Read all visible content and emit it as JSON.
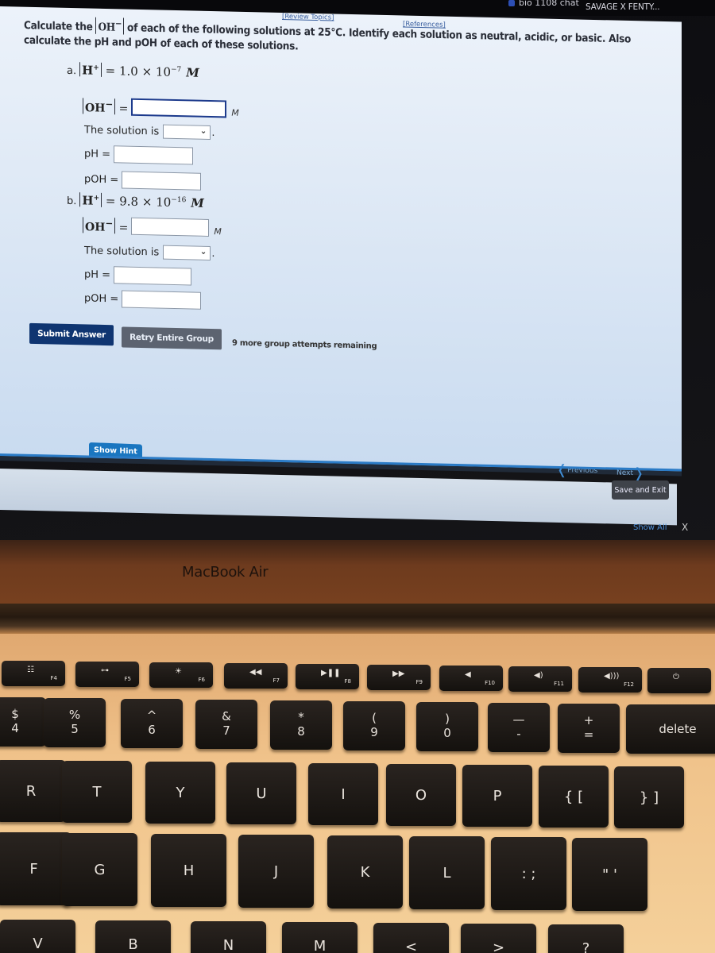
{
  "browser": {
    "tabs": [
      {
        "label": "bio 1108 chat",
        "icon": "favicon-icon"
      },
      {
        "label": "SAVAGE X FENTY..."
      }
    ]
  },
  "links": {
    "review_topics": "[Review Topics]",
    "references": "[References]"
  },
  "question": {
    "text_1": "Calculate the ",
    "chem_oh": "OH",
    "chem_oh_charge": "−",
    "text_2": " of each of the following solutions at 25°C. Identify each solution as neutral, acidic, or basic. Also calculate the pH and pOH of each of these solutions."
  },
  "parts": [
    {
      "letter": "a.",
      "given_species": "H",
      "given_charge": "+",
      "given_value": "= 1.0 × 10",
      "given_exponent": "−7",
      "given_unit": "M",
      "oh_label": "OH",
      "oh_charge": "−",
      "oh_value": "",
      "oh_unit": "M",
      "solution_label": "The solution is",
      "solution_selected": "",
      "ph_label": "pH =",
      "ph_value": "",
      "poh_label": "pOH =",
      "poh_value": ""
    },
    {
      "letter": "b.",
      "given_species": "H",
      "given_charge": "+",
      "given_value": "= 9.8 × 10",
      "given_exponent": "−16",
      "given_unit": "M",
      "oh_label": "OH",
      "oh_charge": "−",
      "oh_value": "",
      "oh_unit": "M",
      "solution_label": "The solution is",
      "solution_selected": "",
      "ph_label": "pH =",
      "ph_value": "",
      "poh_label": "pOH =",
      "poh_value": ""
    }
  ],
  "actions": {
    "submit": "Submit Answer",
    "retry": "Retry Entire Group",
    "attempts": "9 more group attempts remaining"
  },
  "footer": {
    "show_hint": "Show Hint",
    "previous": "Previous",
    "next": "Next",
    "save_exit": "Save and Exit",
    "show_all": "Show All",
    "close": "X"
  },
  "laptop": {
    "label": "MacBook Air"
  },
  "keyboard": {
    "fn_row": [
      {
        "glyph": "☷",
        "label": "F4",
        "icon": "launchpad-icon"
      },
      {
        "glyph": "⊶",
        "label": "F5",
        "icon": "keyboard-backlight-down-icon"
      },
      {
        "glyph": "☀",
        "label": "F6",
        "icon": "keyboard-backlight-up-icon"
      },
      {
        "glyph": "◀◀",
        "label": "F7",
        "icon": "rewind-icon"
      },
      {
        "glyph": "▶❚❚",
        "label": "F8",
        "icon": "play-pause-icon"
      },
      {
        "glyph": "▶▶",
        "label": "F9",
        "icon": "fast-forward-icon"
      },
      {
        "glyph": "◀",
        "label": "F10",
        "icon": "mute-icon"
      },
      {
        "glyph": "◀)",
        "label": "F11",
        "icon": "volume-down-icon"
      },
      {
        "glyph": "◀)))",
        "label": "F12",
        "icon": "volume-up-icon"
      },
      {
        "glyph": "⏻",
        "label": "",
        "icon": "power-icon"
      }
    ],
    "number_row": [
      {
        "top": "$",
        "bot": "4"
      },
      {
        "top": "%",
        "bot": "5"
      },
      {
        "top": "^",
        "bot": "6"
      },
      {
        "top": "&",
        "bot": "7"
      },
      {
        "top": "*",
        "bot": "8"
      },
      {
        "top": "(",
        "bot": "9"
      },
      {
        "top": ")",
        "bot": "0"
      },
      {
        "top": "—",
        "bot": "-"
      },
      {
        "top": "+",
        "bot": "="
      },
      {
        "top": "",
        "bot": "delete"
      }
    ],
    "top_row": [
      "R",
      "T",
      "Y",
      "U",
      "I",
      "O",
      "P",
      "{ [",
      "} ]"
    ],
    "home_row": [
      "F",
      "G",
      "H",
      "J",
      "K",
      "L",
      ": ;",
      "\" '"
    ],
    "bottom_row": [
      "V",
      "B",
      "N",
      "M",
      "<",
      ">",
      "?"
    ]
  }
}
